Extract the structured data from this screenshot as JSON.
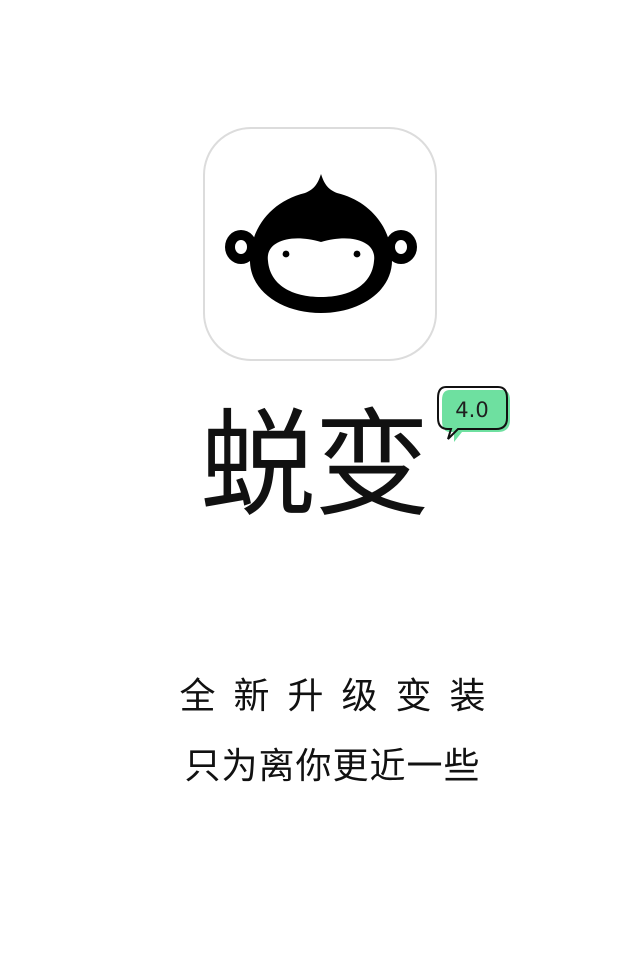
{
  "app": {
    "name": "蜕变",
    "version_badge": "4.0",
    "logo_icon": "monkey-face-icon",
    "badge_color": "#6ee0a0"
  },
  "tagline": {
    "line1": "全新升级变装",
    "line2": "只为离你更近一些"
  }
}
